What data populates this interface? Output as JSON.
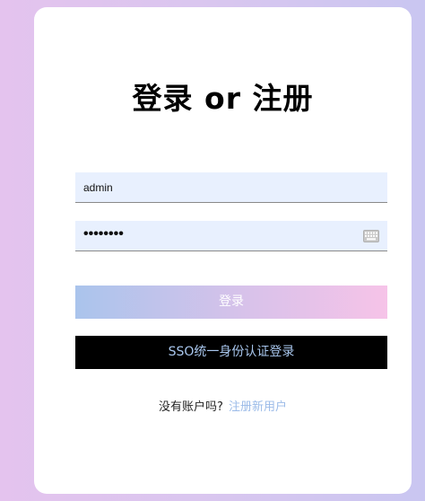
{
  "title": "登录 or 注册",
  "username": {
    "value": "admin"
  },
  "password": {
    "value": "••••••••",
    "icon": "keyboard-icon"
  },
  "buttons": {
    "login_label": "登录",
    "sso_label": "SSO统一身份认证登录"
  },
  "register": {
    "prompt": "没有账户吗?",
    "link_label": "注册新用户"
  },
  "colors": {
    "background_left": "#e4c3ee",
    "background_right": "#c9c6f1",
    "login_gradient_start": "#aac4ec",
    "login_gradient_end": "#f6c3e8",
    "sso_background": "#000000",
    "sso_text": "#a9c7ee",
    "link": "#9bbbe8",
    "input_background": "#e8f0fe"
  }
}
